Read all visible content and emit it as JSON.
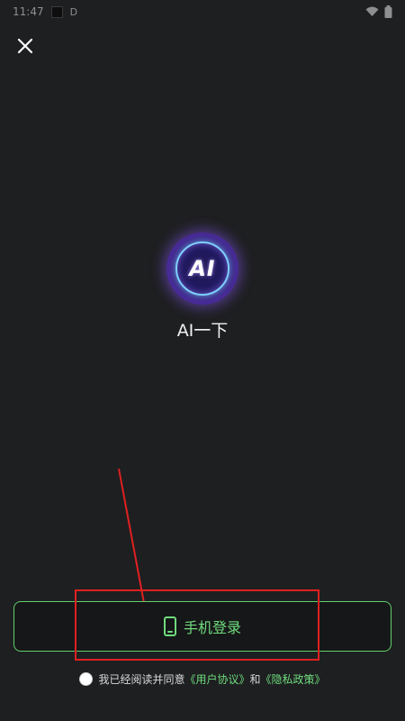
{
  "status_bar": {
    "time": "11:47",
    "extra": "D",
    "icons": [
      "square-icon",
      "wifi-icon",
      "battery-icon"
    ]
  },
  "header": {
    "close_icon": "close-icon"
  },
  "app": {
    "logo_text": "AI",
    "name": "AI一下"
  },
  "login": {
    "button_label": "手机登录",
    "icon": "phone-icon"
  },
  "agreement": {
    "text": "我已经阅读并同意",
    "user_agreement_link": "《用户协议》",
    "and": "和",
    "privacy_link": "《隐私政策》"
  },
  "colors": {
    "background": "#1e1f21",
    "accent": "#6fdc7d",
    "annotation": "#e02020"
  }
}
